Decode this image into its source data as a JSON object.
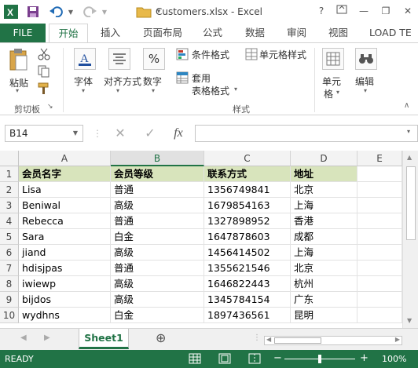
{
  "window": {
    "title": "Customers.xlsx - Excel",
    "help": "?",
    "minimize": "—",
    "restore": "❐",
    "close": "✕"
  },
  "tabs": {
    "file": "FILE",
    "items": [
      "开始",
      "插入",
      "页面布局",
      "公式",
      "数据",
      "审阅",
      "视图",
      "LOAD TE"
    ]
  },
  "ribbon": {
    "paste": "粘贴",
    "clipboard_group": "剪切板",
    "font": "字体",
    "align": "对齐方式",
    "number": "数字",
    "cond_format": "条件格式",
    "table_format_1": "套用",
    "table_format_2": "表格格式",
    "cell_style": "单元格样式",
    "style_group": "样式",
    "cells_1": "单元",
    "cells_2": "格",
    "editing": "编辑",
    "percent": "%"
  },
  "formula_bar": {
    "name_box": "B14",
    "fx": "fx",
    "value": ""
  },
  "grid": {
    "columns": [
      "A",
      "B",
      "C",
      "D",
      "E"
    ],
    "selected_column": "B",
    "rows": [
      [
        "1",
        "会员名字",
        "会员等级",
        "联系方式",
        "地址"
      ],
      [
        "2",
        "Lisa",
        "普通",
        "1356749841",
        "北京"
      ],
      [
        "3",
        "Beniwal",
        "高级",
        "1679854163",
        "上海"
      ],
      [
        "4",
        "Rebecca",
        "普通",
        "1327898952",
        "香港"
      ],
      [
        "5",
        "Sara",
        "白金",
        "1647878603",
        "成都"
      ],
      [
        "6",
        "jiand",
        "高级",
        "1456414502",
        "上海"
      ],
      [
        "7",
        "hdisjpas",
        "普通",
        "1355621546",
        "北京"
      ],
      [
        "8",
        "iwiewp",
        "高级",
        "1646822443",
        "杭州"
      ],
      [
        "9",
        "bijdos",
        "高级",
        "1345784154",
        "广东"
      ],
      [
        "10",
        "wydhns",
        "白金",
        "1897436561",
        "昆明"
      ]
    ]
  },
  "sheets": {
    "active": "Sheet1",
    "add": "⊕"
  },
  "status": {
    "mode": "READY",
    "zoom": "100%",
    "zoom_minus": "−",
    "zoom_plus": "+"
  },
  "colors": {
    "accent": "#217346",
    "header_fill": "#d8e4bc"
  }
}
